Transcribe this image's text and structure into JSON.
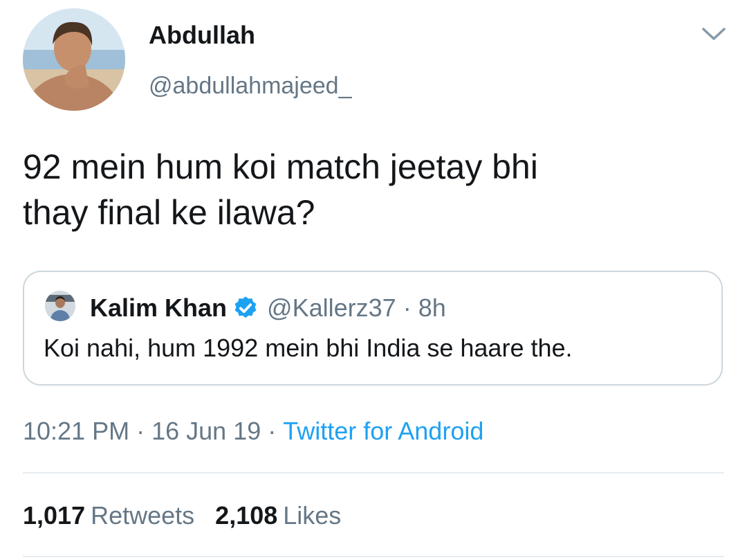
{
  "author": {
    "name": "Abdullah",
    "handle": "@abdullahmajeed_"
  },
  "tweet": {
    "text_line1": "92 mein hum koi match jeetay bhi",
    "text_line2": "thay final ke ilawa?"
  },
  "quoted_tweet": {
    "name": "Kalim Khan",
    "verified": true,
    "handle": "@Kallerz37",
    "separator": "·",
    "time": "8h",
    "text": "Koi nahi, hum 1992 mein bhi India se haare the."
  },
  "meta": {
    "time": "10:21 PM",
    "date": "16 Jun 19",
    "separator": "·",
    "source": "Twitter for Android"
  },
  "stats": {
    "retweets_count": "1,017",
    "retweets_label": "Retweets",
    "likes_count": "2,108",
    "likes_label": "Likes"
  },
  "colors": {
    "text_primary": "#14171a",
    "text_secondary": "#657786",
    "link": "#1da1f2",
    "border": "#ccd6dd",
    "verified_badge": "#1da1f2"
  },
  "icons": {
    "menu": "chevron-down-icon",
    "verified": "verified-badge-icon"
  }
}
